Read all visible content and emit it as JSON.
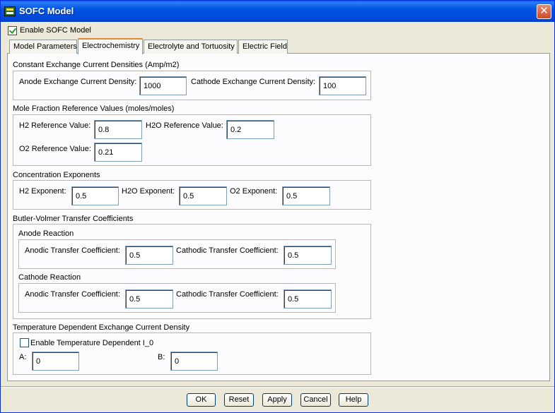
{
  "window": {
    "title": "SOFC Model",
    "close_label": "✕"
  },
  "enable_sofc": {
    "label": "Enable SOFC Model",
    "checked": true
  },
  "tabs": [
    {
      "label": "Model Parameters",
      "active": false
    },
    {
      "label": "Electrochemistry",
      "active": true
    },
    {
      "label": "Electrolyte and Tortuosity",
      "active": false
    },
    {
      "label": "Electric Field",
      "active": false
    }
  ],
  "exchange_current": {
    "title": "Constant Exchange Current Densities (Amp/m2)",
    "anode_label": "Anode Exchange Current Density:",
    "anode_value": "1000",
    "cathode_label": "Cathode Exchange Current Density:",
    "cathode_value": "100"
  },
  "mole_fraction": {
    "title": "Mole Fraction Reference Values (moles/moles)",
    "h2_label": "H2 Reference Value:",
    "h2_value": "0.8",
    "h2o_label": "H2O Reference Value:",
    "h2o_value": "0.2",
    "o2_label": "O2 Reference Value:",
    "o2_value": "0.21"
  },
  "concentration": {
    "title": "Concentration Exponents",
    "h2_label": "H2 Exponent:",
    "h2_value": "0.5",
    "h2o_label": "H2O Exponent:",
    "h2o_value": "0.5",
    "o2_label": "O2 Exponent:",
    "o2_value": "0.5"
  },
  "butler_volmer": {
    "title": "Butler-Volmer Transfer Coefficients",
    "anode": {
      "title": "Anode Reaction",
      "anodic_label": "Anodic Transfer Coefficient:",
      "anodic_value": "0.5",
      "cathodic_label": "Cathodic Transfer Coefficient:",
      "cathodic_value": "0.5"
    },
    "cathode": {
      "title": "Cathode Reaction",
      "anodic_label": "Anodic Transfer Coefficient:",
      "anodic_value": "0.5",
      "cathodic_label": "Cathodic Transfer Coefficient:",
      "cathodic_value": "0.5"
    }
  },
  "temperature": {
    "title": "Temperature Dependent Exchange Current Density",
    "enable_label": "Enable Temperature Dependent I_0",
    "enable_checked": false,
    "a_label": "A:",
    "a_value": "0",
    "b_label": "B:",
    "b_value": "0"
  },
  "buttons": {
    "ok": "OK",
    "reset": "Reset",
    "apply": "Apply",
    "cancel": "Cancel",
    "help": "Help"
  }
}
